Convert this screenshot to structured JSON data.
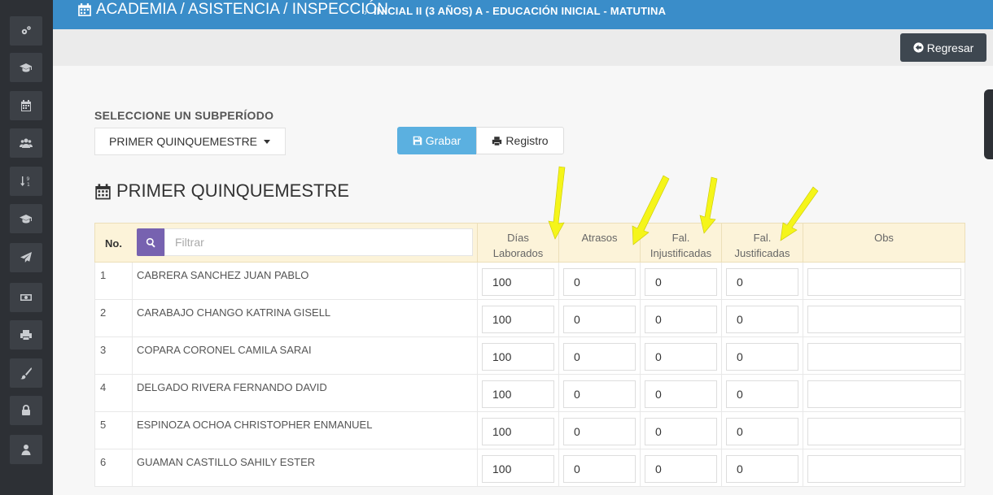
{
  "header": {
    "title": "ACADEMIA / ASISTENCIA / INSPECCIÓN",
    "separator": "›",
    "subtitle": "INICIAL II (3 AÑOS) A - EDUCACIÓN INICIAL - MATUTINA"
  },
  "sidebar": {
    "items": [
      {
        "icon": "cogs-icon"
      },
      {
        "icon": "graduation-cap-icon"
      },
      {
        "icon": "calendar-icon"
      },
      {
        "icon": "users-icon"
      },
      {
        "icon": "sort-numeric-icon"
      },
      {
        "icon": "graduation-cap-icon"
      },
      {
        "icon": "paper-plane-icon"
      },
      {
        "icon": "money-icon"
      },
      {
        "icon": "print-icon"
      },
      {
        "icon": "paint-brush-icon"
      },
      {
        "icon": "lock-icon"
      },
      {
        "icon": "user-icon"
      }
    ]
  },
  "toolbar": {
    "back_label": "Regresar"
  },
  "subperiod": {
    "label": "SELECCIONE UN SUBPERÍODO",
    "selected": "PRIMER QUINQUEMESTRE"
  },
  "actions": {
    "save_label": "Grabar",
    "register_label": "Registro"
  },
  "section_title": "PRIMER QUINQUEMESTRE",
  "table": {
    "col_no": "No.",
    "search_placeholder": "Filtrar",
    "col_dias_1": "Días",
    "col_dias_2": "Laborados",
    "col_atrasos": "Atrasos",
    "col_faljust_1": "Fal.",
    "col_faljust_2": "Injustificadas",
    "col_faljus_1": "Fal.",
    "col_faljus_2": "Justificadas",
    "col_obs": "Obs",
    "rows": [
      {
        "no": "1",
        "name": "CABRERA SANCHEZ JUAN PABLO",
        "dias": "100",
        "atrasos": "0",
        "injust": "0",
        "just": "0"
      },
      {
        "no": "2",
        "name": "CARABAJO CHANGO KATRINA GISELL",
        "dias": "100",
        "atrasos": "0",
        "injust": "0",
        "just": "0"
      },
      {
        "no": "3",
        "name": "COPARA CORONEL CAMILA SARAI",
        "dias": "100",
        "atrasos": "0",
        "injust": "0",
        "just": "0"
      },
      {
        "no": "4",
        "name": "DELGADO RIVERA FERNANDO DAVID",
        "dias": "100",
        "atrasos": "0",
        "injust": "0",
        "just": "0"
      },
      {
        "no": "5",
        "name": "ESPINOZA OCHOA CHRISTOPHER ENMANUEL",
        "dias": "100",
        "atrasos": "0",
        "injust": "0",
        "just": "0"
      },
      {
        "no": "6",
        "name": "GUAMAN CASTILLO SAHILY ESTER",
        "dias": "100",
        "atrasos": "0",
        "injust": "0",
        "just": "0"
      }
    ]
  },
  "colors": {
    "header_bg": "#3a8dc9",
    "sidebar_bg": "#2d3035",
    "table_header_bg": "#fcf3d9",
    "save_button_bg": "#5bb0e0",
    "search_button_bg": "#7762b0",
    "annotation_arrow": "#f5f51a"
  }
}
